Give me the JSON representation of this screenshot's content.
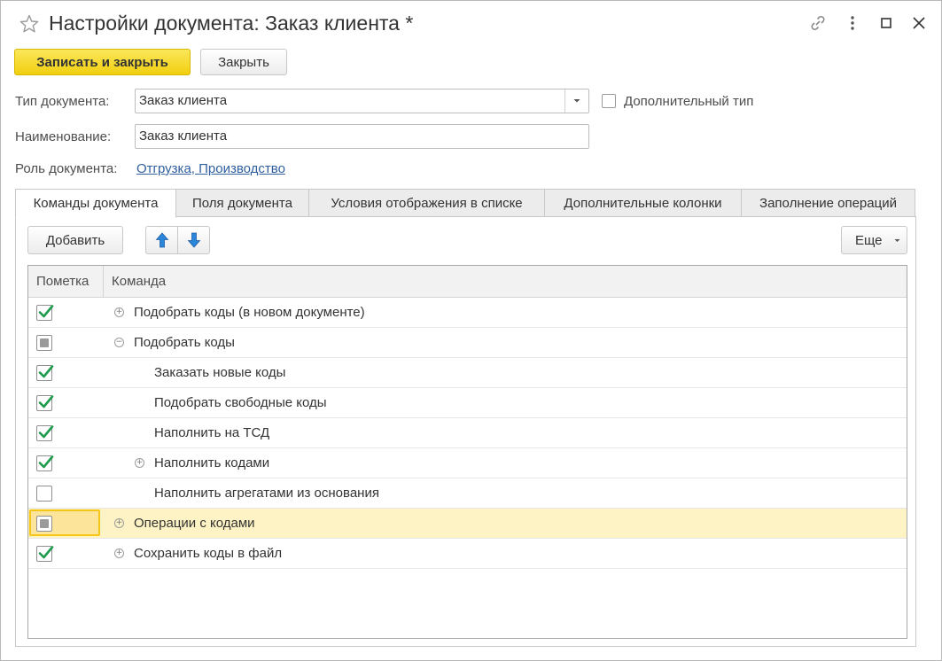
{
  "window": {
    "title": "Настройки документа: Заказ клиента *"
  },
  "toolbar": {
    "save_close_label": "Записать и закрыть",
    "close_label": "Закрыть"
  },
  "form": {
    "doc_type_label": "Тип документа:",
    "doc_type_value": "Заказ клиента",
    "extra_type_label": "Дополнительный тип",
    "name_label": "Наименование:",
    "name_value": "Заказ клиента",
    "role_label": "Роль документа:",
    "role_value": "Отгрузка, Производство"
  },
  "tabs": [
    {
      "label": "Команды документа",
      "active": true
    },
    {
      "label": "Поля документа",
      "active": false
    },
    {
      "label": "Условия отображения в списке",
      "active": false
    },
    {
      "label": "Дополнительные колонки",
      "active": false
    },
    {
      "label": "Заполнение операций",
      "active": false
    }
  ],
  "commands_panel": {
    "add_label": "Добавить",
    "more_label": "Еще",
    "columns": [
      "Пометка",
      "Команда"
    ],
    "rows": [
      {
        "mark": "checked",
        "expander": "plus",
        "level": 0,
        "text": "Подобрать коды (в новом документе)"
      },
      {
        "mark": "partial",
        "expander": "minus",
        "level": 0,
        "text": "Подобрать коды"
      },
      {
        "mark": "checked",
        "expander": "none",
        "level": 1,
        "text": "Заказать новые коды"
      },
      {
        "mark": "checked",
        "expander": "none",
        "level": 1,
        "text": "Подобрать свободные коды"
      },
      {
        "mark": "checked",
        "expander": "none",
        "level": 1,
        "text": "Наполнить на ТСД"
      },
      {
        "mark": "checked",
        "expander": "plus",
        "level": 1,
        "text": "Наполнить кодами"
      },
      {
        "mark": "unchecked",
        "expander": "none",
        "level": 1,
        "text": "Наполнить агрегатами из основания"
      },
      {
        "mark": "partial",
        "expander": "plus",
        "level": 0,
        "text": "Операции с кодами",
        "selected": true
      },
      {
        "mark": "checked",
        "expander": "plus",
        "level": 0,
        "text": "Сохранить коды в файл"
      }
    ]
  },
  "colors": {
    "primary_button": "#f5d824",
    "check_green": "#1f9b4c",
    "selected_row": "#fdf3c4",
    "link": "#2f5f9e",
    "arrow_blue": "#2b86d9"
  },
  "icons": [
    "star-icon",
    "link-icon",
    "more-vert-icon",
    "maximize-icon",
    "close-icon",
    "dropdown-arrow-icon",
    "move-up-icon",
    "move-down-icon"
  ]
}
